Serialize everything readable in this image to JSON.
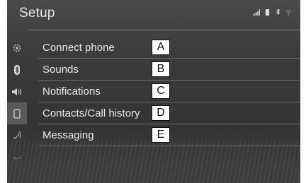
{
  "screen": {
    "title": "Setup"
  },
  "status_icons": [
    "signal-bars-icon",
    "phone-battery-icon",
    "bluetooth-icon",
    "wifi-icon"
  ],
  "sidebar": {
    "items": [
      {
        "icon": "gear-icon"
      },
      {
        "icon": "bluetooth-icon"
      },
      {
        "icon": "speaker-icon"
      },
      {
        "icon": "phone-icon",
        "selected": true
      },
      {
        "icon": "voice-command-icon"
      },
      {
        "icon": "back-arrow-icon"
      }
    ]
  },
  "menu": {
    "items": [
      {
        "label": "Connect phone",
        "callout": "A"
      },
      {
        "label": "Sounds",
        "callout": "B"
      },
      {
        "label": "Notifications",
        "callout": "C"
      },
      {
        "label": "Contacts/Call history",
        "callout": "D"
      },
      {
        "label": "Messaging",
        "callout": "E"
      }
    ]
  },
  "colors": {
    "background": "#3b3b3b",
    "text": "#e9e9e9",
    "divider": "#6b6b6b"
  }
}
